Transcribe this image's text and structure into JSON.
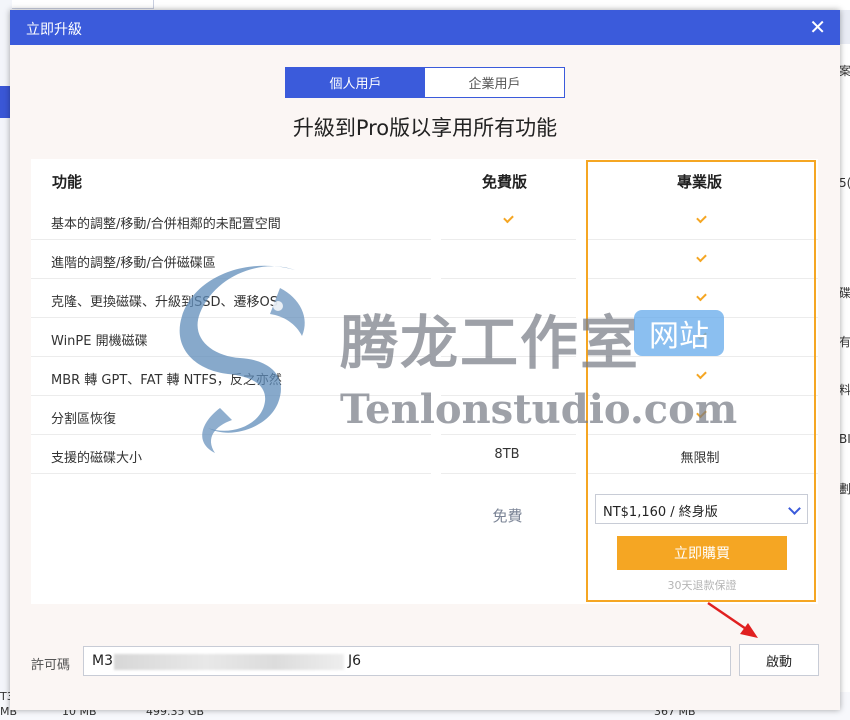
{
  "background": {
    "right_edge_texts": [
      "案",
      "5(",
      "碟",
      "有",
      "料",
      "BI",
      "劃"
    ],
    "bottom_texts": [
      "MB",
      "10 MB",
      "499.35 GB",
      "367 MB"
    ],
    "bottom_left_snippet": "T3"
  },
  "dialog": {
    "title": "立即升級",
    "close_glyph": "✕",
    "tabs": [
      {
        "label": "個人用戶",
        "active": true
      },
      {
        "label": "企業用戶",
        "active": false
      }
    ],
    "headline": "升級到Pro版以享用所有功能",
    "columns": {
      "feature": "功能",
      "free": "免費版",
      "pro": "專業版"
    },
    "rows": [
      {
        "name": "基本的調整/移動/合併相鄰的未配置空間",
        "free": "check",
        "pro": "check"
      },
      {
        "name": "進階的調整/移動/合併磁碟區",
        "free": "",
        "pro": "check"
      },
      {
        "name": "克隆、更換磁碟、升級到SSD、遷移OS",
        "free": "",
        "pro": "check"
      },
      {
        "name": "WinPE 開機磁碟",
        "free": "",
        "pro": "check"
      },
      {
        "name": "MBR 轉 GPT、FAT 轉 NTFS，反之亦然",
        "free": "",
        "pro": "check"
      },
      {
        "name": "分割區恢復",
        "free": "",
        "pro": "check"
      },
      {
        "name": "支援的磁碟大小",
        "free": "8TB",
        "pro": "無限制"
      }
    ],
    "free_price_label": "免費",
    "pro_price_select": "NT$1,160 / 終身版",
    "buy_button": "立即購買",
    "refund_note": "30天退款保證",
    "license": {
      "label": "許可碼",
      "value_start": "M3",
      "value_end": "J6"
    },
    "activate_button": "啟動"
  },
  "watermark": {
    "cn": "腾龙工作室",
    "badge": "网站",
    "en": "Tenlonstudio.com"
  },
  "colors": {
    "primary": "#3b5bdb",
    "accent": "#f5a623",
    "arrow": "#e02020"
  }
}
